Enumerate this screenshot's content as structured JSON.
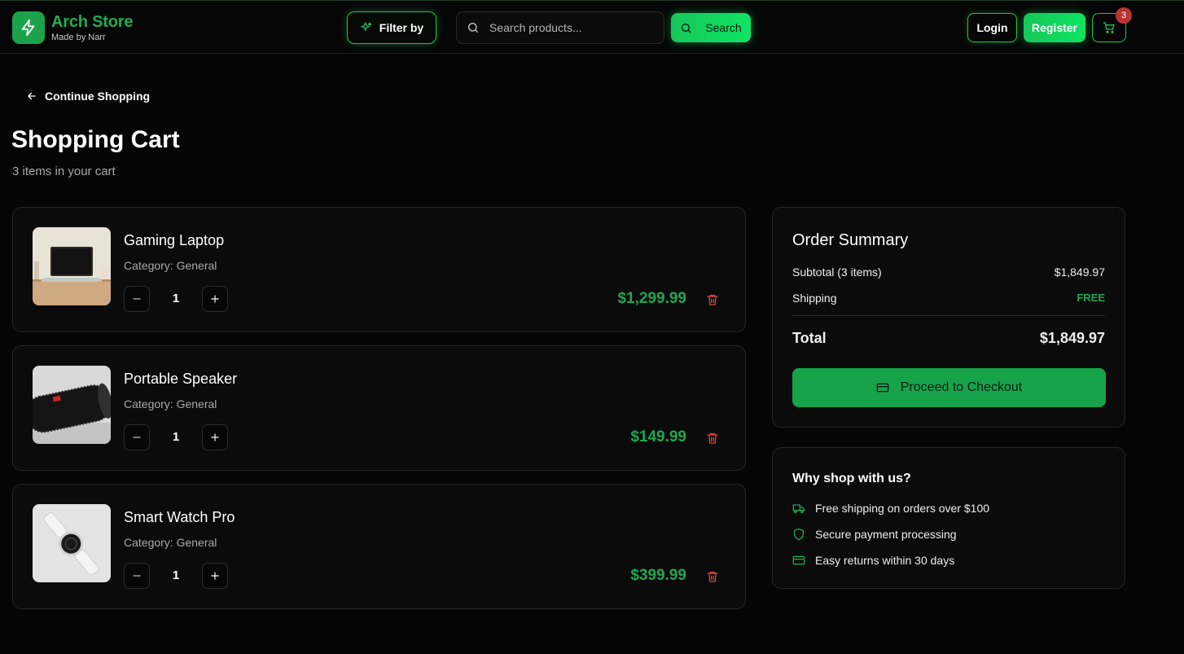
{
  "header": {
    "brand_name": "Arch Store",
    "brand_sub": "Made by Narr",
    "filter_label": "Filter by",
    "search_placeholder": "Search products...",
    "search_label": "Search",
    "login_label": "Login",
    "register_label": "Register",
    "cart_count": "3"
  },
  "page": {
    "continue_label": "Continue Shopping",
    "title": "Shopping Cart",
    "subtitle": "3 items in your cart"
  },
  "cart": {
    "items": [
      {
        "name": "Gaming Laptop",
        "category": "Category: General",
        "quantity": "1",
        "price": "$1,299.99",
        "image": "laptop-photo"
      },
      {
        "name": "Portable Speaker",
        "category": "Category: General",
        "quantity": "1",
        "price": "$149.99",
        "image": "speaker-photo"
      },
      {
        "name": "Smart Watch Pro",
        "category": "Category: General",
        "quantity": "1",
        "price": "$399.99",
        "image": "smartwatch-photo"
      }
    ]
  },
  "summary": {
    "title": "Order Summary",
    "subtotal_label": "Subtotal (3 items)",
    "subtotal_value": "$1,849.97",
    "shipping_label": "Shipping",
    "shipping_value": "FREE",
    "total_label": "Total",
    "total_value": "$1,849.97",
    "checkout_label": "Proceed to Checkout"
  },
  "why": {
    "title": "Why shop with us?",
    "items": [
      {
        "icon": "truck-icon",
        "text": "Free shipping on orders over $100"
      },
      {
        "icon": "shield-icon",
        "text": "Secure payment processing"
      },
      {
        "icon": "credit-card-icon",
        "text": "Easy returns within 30 days"
      }
    ]
  },
  "colors": {
    "accent": "#1fae50",
    "price": "#22a552",
    "danger": "#d9453f",
    "background": "#050505",
    "card": "#0b0b0c"
  }
}
